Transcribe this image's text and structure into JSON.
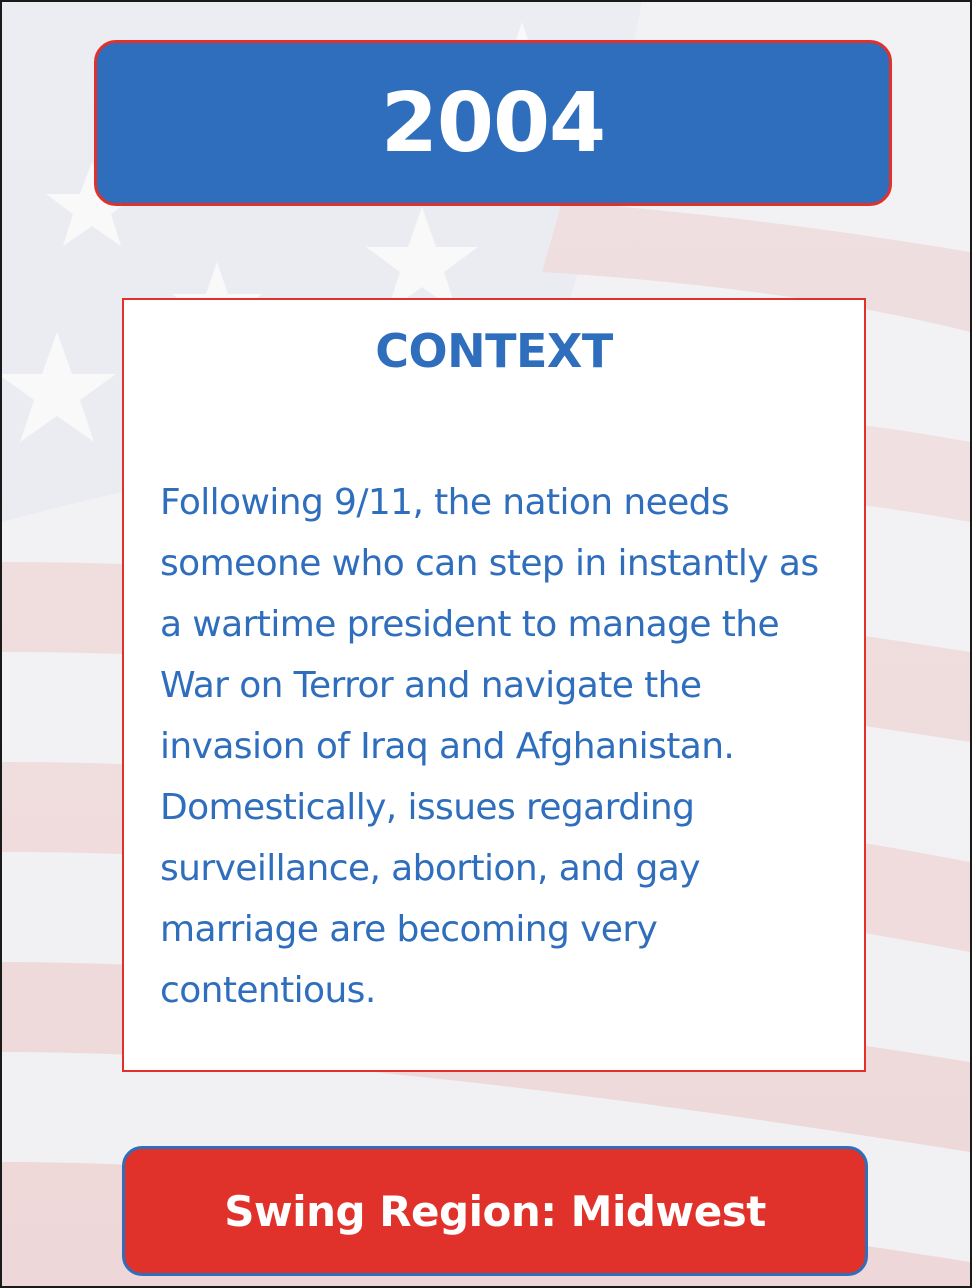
{
  "year": "2004",
  "context": {
    "heading": "CONTEXT",
    "body": "Following 9/11, the nation needs someone who can step in instantly as a wartime president to manage the War on Terror and navigate the invasion of Iraq and Afghanistan. Domestically, issues regarding surveillance, abortion, and gay marriage are becoming very contentious."
  },
  "region": "Swing Region: Midwest",
  "colors": {
    "blue": "#2f6ebc",
    "red": "#e0312a",
    "white": "#ffffff"
  },
  "background": "faded-american-flag"
}
